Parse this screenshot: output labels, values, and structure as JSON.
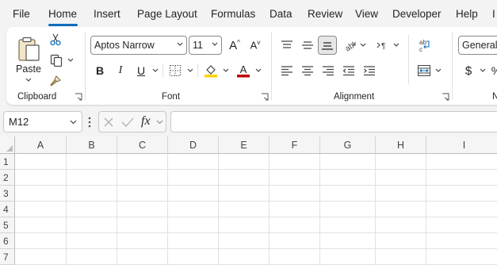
{
  "menu": {
    "tabs": [
      "File",
      "Home",
      "Insert",
      "Page Layout",
      "Formulas",
      "Data",
      "Review",
      "View",
      "Developer",
      "Help",
      "I"
    ],
    "active": "Home"
  },
  "ribbon": {
    "clipboard": {
      "label": "Clipboard",
      "paste_label": "Paste"
    },
    "font": {
      "label": "Font",
      "font_name": "Aptos Narrow",
      "font_size": "11",
      "bold": "B",
      "italic": "I",
      "underline": "U"
    },
    "alignment": {
      "label": "Alignment"
    },
    "number": {
      "format": "General",
      "label": "N"
    }
  },
  "formula_bar": {
    "name_box": "M12",
    "fx_label": "fx",
    "formula": ""
  },
  "sheet": {
    "columns": [
      "A",
      "B",
      "C",
      "D",
      "E",
      "F",
      "G",
      "H",
      "I"
    ],
    "rows": [
      "1",
      "2",
      "3",
      "4",
      "5",
      "6",
      "7"
    ]
  },
  "colors": {
    "accent": "#0f6cbd",
    "fill_highlight": "#ffd200",
    "font_color": "#c00000"
  }
}
